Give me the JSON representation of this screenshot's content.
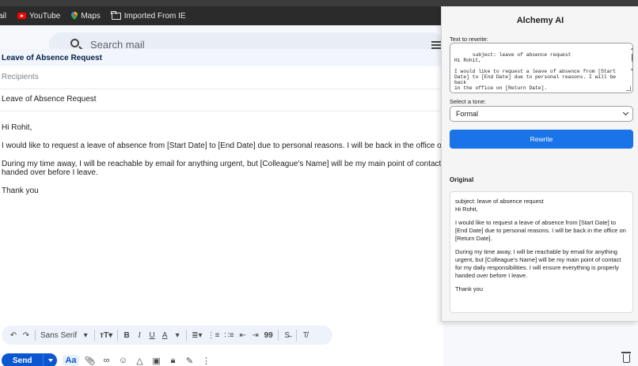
{
  "bookmarks": [
    {
      "label": "ail",
      "icon": "none"
    },
    {
      "label": "YouTube",
      "icon": "youtube-icon"
    },
    {
      "label": "Maps",
      "icon": "maps-pin-icon"
    },
    {
      "label": "Imported From IE",
      "icon": "folder-icon"
    }
  ],
  "search": {
    "placeholder": "Search mail"
  },
  "compose": {
    "header_title": "Leave of Absence Request",
    "recipients_placeholder": "Recipients",
    "subject": "Leave of Absence Request",
    "body": {
      "greeting": "Hi Rohit,",
      "para1": "I would like to request a leave of absence from [Start Date] to [End Date] due to personal reasons. I will be back in the office on [Return I",
      "para2_line1": "During my time away, I will be reachable by email for anything urgent, but [Colleague's Name] will be my main point of contact for my dai",
      "para2_line2": "handed over before I leave.",
      "closing": "Thank you"
    },
    "format": {
      "font": "Sans Serif",
      "bold": "B",
      "italic": "I",
      "underline": "U",
      "text_color": "A",
      "quote": "99"
    },
    "send_label": "Send",
    "aa_label": "Aa"
  },
  "panel": {
    "title": "Alchemy AI",
    "text_label": "Text to rewrite:",
    "text_value": "subject: leave of absence request\nHi Rohit,\n\nI would like to request a leave of absence from [Start\nDate] to [End Date] due to personal reasons. I will be back\nin the office on [Return Date].",
    "tone_label": "Select a tone:",
    "tone_value": "Formal",
    "rewrite_label": "Rewrite",
    "original_title": "Original",
    "original": {
      "line1": "subject: leave of absence request",
      "line2": "Hi Rohit,",
      "para1": "I would like to request a leave of absence from [Start Date] to [End Date] due to personal reasons. I will be back in the office on [Return Date].",
      "para2": "During my time away, I will be reachable by email for anything urgent, but [Colleague's Name] will be my main point of contact for my daily responsibilities. I will ensure everything is properly handed over before I leave.",
      "closing": "Thank you"
    }
  },
  "colors": {
    "send": "#0b57d0",
    "rewrite": "#1a73e8",
    "youtube": "#ff0000"
  }
}
